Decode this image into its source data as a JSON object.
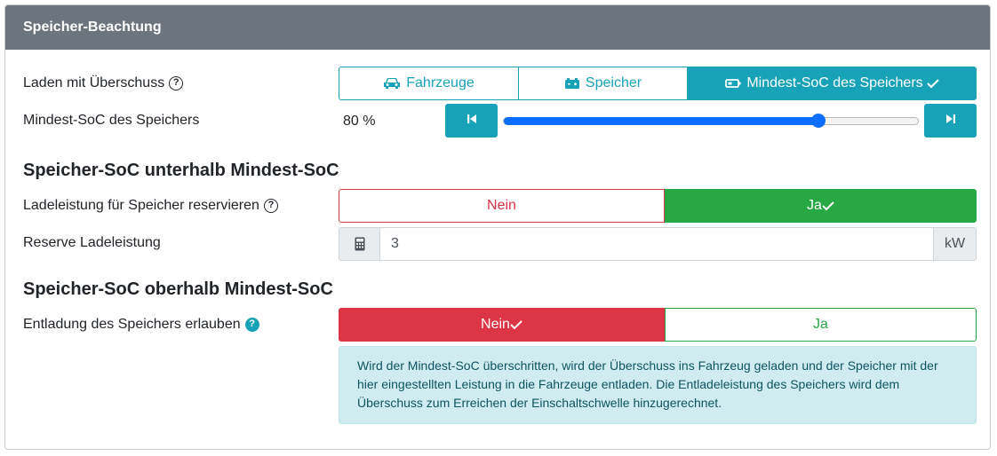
{
  "card": {
    "title": "Speicher-Beachtung"
  },
  "row1": {
    "label": "Laden mit Überschuss",
    "options": [
      {
        "label": "Fahrzeuge",
        "icon": "car-icon"
      },
      {
        "label": "Speicher",
        "icon": "battery-car-icon"
      },
      {
        "label": "Mindest-SoC des Speichers",
        "icon": "battery-icon",
        "selected": true
      }
    ]
  },
  "row2": {
    "label": "Mindest-SoC des Speichers",
    "value_text": "80 %",
    "value_fraction": 0.8
  },
  "section1": {
    "title": "Speicher-SoC unterhalb Mindest-SoC"
  },
  "row3": {
    "label": "Ladeleistung für Speicher reservieren",
    "no": "Nein",
    "yes": "Ja",
    "selected": "yes"
  },
  "row4": {
    "label": "Reserve Ladeleistung",
    "value": "3",
    "unit": "kW"
  },
  "section2": {
    "title": "Speicher-SoC oberhalb Mindest-SoC"
  },
  "row5": {
    "label": "Entladung des Speichers erlauben",
    "no": "Nein",
    "yes": "Ja",
    "selected": "no"
  },
  "info": {
    "line1": "Wird der Mindest-SoC überschritten, wird der Überschuss ins Fahrzeug geladen und der Speicher mit der",
    "line2": "hier eingestellten Leistung in die Fahrzeuge entladen. Die Entladeleistung des Speichers wird dem",
    "line3": "Überschuss zum Erreichen der Einschaltschwelle hinzugerechnet."
  },
  "colors": {
    "header": "#6c757d",
    "info": "#17a2b8",
    "success": "#28a745",
    "danger": "#dc3545",
    "slider": "#0d6efd"
  }
}
